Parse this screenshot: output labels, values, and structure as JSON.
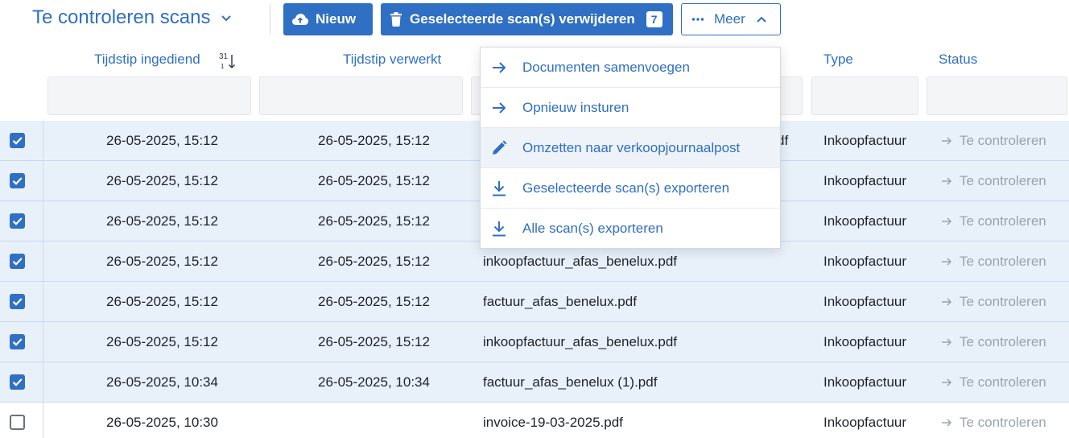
{
  "toolbar": {
    "title": "Te controleren scans",
    "new_label": "Nieuw",
    "delete_label": "Geselecteerde scan(s) verwijderen",
    "selected_count": "7",
    "more_label": "Meer"
  },
  "columns": {
    "submitted": "Tijdstip ingediend",
    "sort_indicator_top": "31",
    "sort_indicator_bottom": "1",
    "processed": "Tijdstip verwerkt",
    "type": "Type",
    "status": "Status"
  },
  "menu": {
    "items": [
      {
        "label": "Documenten samenvoegen",
        "icon": "arrow-right-icon"
      },
      {
        "label": "Opnieuw insturen",
        "icon": "arrow-right-icon"
      },
      {
        "label": "Omzetten naar verkoopjournaalpost",
        "icon": "pencil-icon"
      },
      {
        "label": "Geselecteerde scan(s) exporteren",
        "icon": "download-icon"
      },
      {
        "label": "Alle scan(s) exporteren",
        "icon": "download-icon"
      }
    ]
  },
  "rows": [
    {
      "checked": true,
      "submitted": "26-05-2025, 15:12",
      "processed": "26-05-2025, 15:12",
      "file": "df",
      "type": "Inkoopfactuur",
      "status": "Te controleren"
    },
    {
      "checked": true,
      "submitted": "26-05-2025, 15:12",
      "processed": "26-05-2025, 15:12",
      "file": "",
      "type": "Inkoopfactuur",
      "status": "Te controleren"
    },
    {
      "checked": true,
      "submitted": "26-05-2025, 15:12",
      "processed": "26-05-2025, 15:12",
      "file": "",
      "type": "Inkoopfactuur",
      "status": "Te controleren"
    },
    {
      "checked": true,
      "submitted": "26-05-2025, 15:12",
      "processed": "26-05-2025, 15:12",
      "file": "inkoopfactuur_afas_benelux.pdf",
      "type": "Inkoopfactuur",
      "status": "Te controleren"
    },
    {
      "checked": true,
      "submitted": "26-05-2025, 15:12",
      "processed": "26-05-2025, 15:12",
      "file": "factuur_afas_benelux.pdf",
      "type": "Inkoopfactuur",
      "status": "Te controleren"
    },
    {
      "checked": true,
      "submitted": "26-05-2025, 15:12",
      "processed": "26-05-2025, 15:12",
      "file": "inkoopfactuur_afas_benelux.pdf",
      "type": "Inkoopfactuur",
      "status": "Te controleren"
    },
    {
      "checked": true,
      "submitted": "26-05-2025, 10:34",
      "processed": "26-05-2025, 10:34",
      "file": "factuur_afas_benelux (1).pdf",
      "type": "Inkoopfactuur",
      "status": "Te controleren"
    },
    {
      "checked": false,
      "submitted": "26-05-2025, 10:30",
      "processed": "",
      "file": "invoice-19-03-2025.pdf",
      "type": "Inkoopfactuur",
      "status": "Te controleren"
    }
  ],
  "colors": {
    "accent": "#2f6fc4",
    "selected_row": "#e8f0fa",
    "status_text": "#9aa3ad"
  }
}
